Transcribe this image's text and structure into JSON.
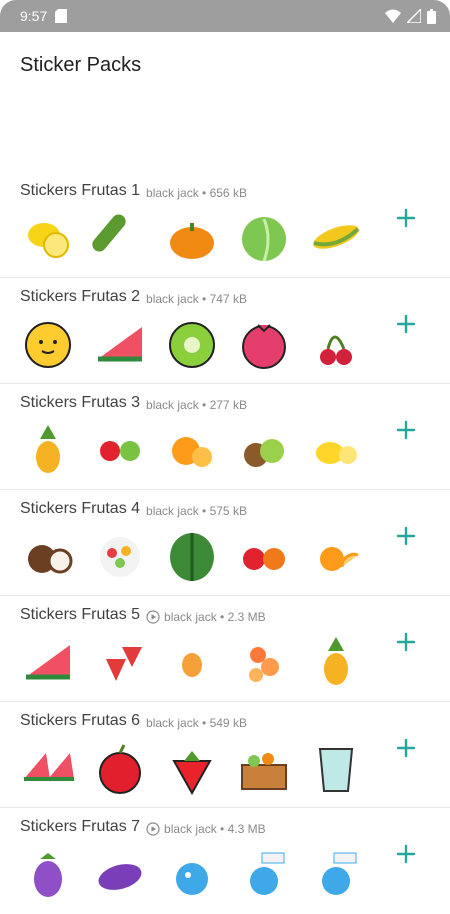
{
  "status_bar": {
    "time": "9:57"
  },
  "header": {
    "title": "Sticker Packs"
  },
  "colors": {
    "accent": "#26a69a",
    "status_bar": "#9e9e9e"
  },
  "packs": [
    {
      "name": "Stickers Frutas 1",
      "meta": "black jack • 656 kB",
      "animated": false,
      "stickers": [
        "lemon",
        "cucumber",
        "pumpkin",
        "cabbage",
        "corn"
      ]
    },
    {
      "name": "Stickers Frutas 2",
      "meta": "black jack • 747 kB",
      "animated": false,
      "stickers": [
        "orange-face",
        "watermelon-slice",
        "kiwi-face",
        "pomegranate-face",
        "cherries"
      ]
    },
    {
      "name": "Stickers Frutas 3",
      "meta": "black jack • 277 kB",
      "animated": false,
      "stickers": [
        "pineapple",
        "apples",
        "oranges",
        "kiwis",
        "lemons"
      ]
    },
    {
      "name": "Stickers Frutas 4",
      "meta": "black jack • 575 kB",
      "animated": false,
      "stickers": [
        "coconut",
        "fruit-salad",
        "watermelon",
        "cherries-pair",
        "orange-slices"
      ]
    },
    {
      "name": "Stickers Frutas 5",
      "meta": "black jack • 2.3 MB",
      "animated": true,
      "stickers": [
        "watermelon-slice",
        "strawberries",
        "mango",
        "peach-pieces",
        "pineapple"
      ]
    },
    {
      "name": "Stickers Frutas 6",
      "meta": "black jack • 549 kB",
      "animated": false,
      "stickers": [
        "watermelon-slices",
        "red-apple",
        "strawberry",
        "vegetable-crate",
        "water-glass"
      ]
    },
    {
      "name": "Stickers Frutas 7",
      "meta": "black jack • 4.3 MB",
      "animated": true,
      "stickers": [
        "eggplant",
        "eggplant-lying",
        "blue-bird",
        "blue-bird-sign",
        "blue-bird-sign"
      ]
    }
  ]
}
